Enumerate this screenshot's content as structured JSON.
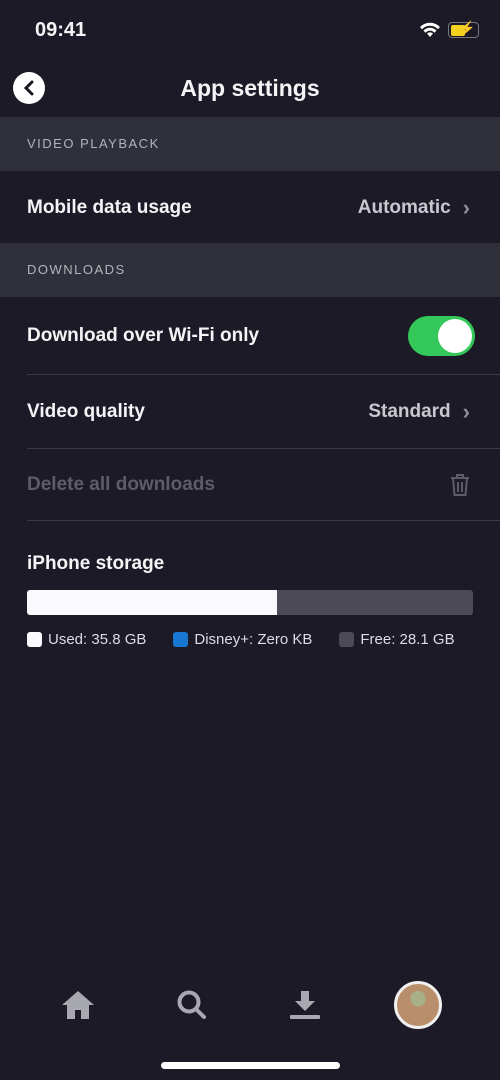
{
  "status_bar": {
    "time": "09:41",
    "icons": [
      "wifi-icon",
      "battery-charging-icon"
    ],
    "battery_color": "#f2d21c"
  },
  "header": {
    "title": "App settings",
    "back_icon": "chevron-left-icon"
  },
  "sections": {
    "video_playback": {
      "title": "VIDEO PLAYBACK",
      "mobile_data": {
        "label": "Mobile data usage",
        "value": "Automatic"
      }
    },
    "downloads": {
      "title": "DOWNLOADS",
      "wifi_only": {
        "label": "Download over Wi-Fi only",
        "enabled": true
      },
      "video_quality": {
        "label": "Video quality",
        "value": "Standard"
      },
      "delete_all": {
        "label": "Delete all downloads",
        "icon": "trash-icon"
      }
    }
  },
  "storage": {
    "title": "iPhone storage",
    "used_fraction": 0.56,
    "legend": [
      {
        "label": "Used: 35.8 GB",
        "color": "#fafafe"
      },
      {
        "label": "Disney+: Zero KB",
        "color": "#1877d2"
      },
      {
        "label": "Free: 28.1 GB",
        "color": "#4b4a56"
      }
    ]
  },
  "tabbar": {
    "items": [
      "home-icon",
      "search-icon",
      "download-icon",
      "profile-avatar"
    ]
  },
  "colors": {
    "background": "#1b1a26",
    "section": "#30303b",
    "toggle_on": "#34c85a"
  }
}
